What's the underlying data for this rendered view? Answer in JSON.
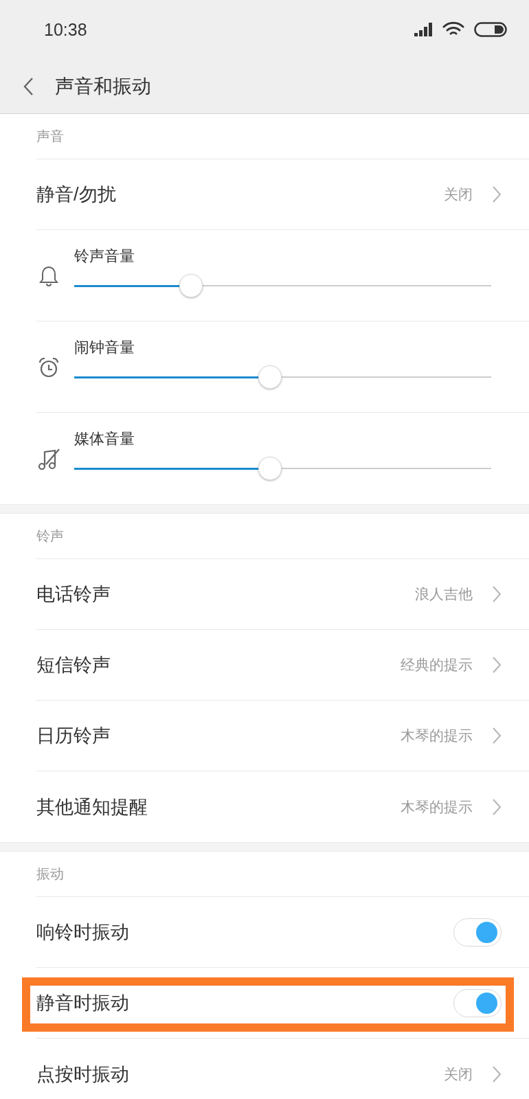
{
  "status_bar": {
    "time": "10:38"
  },
  "header": {
    "title": "声音和振动"
  },
  "sections": [
    {
      "title": "声音",
      "items": [
        {
          "kind": "link",
          "label": "静音/勿扰",
          "value": "关闭",
          "highlighted": false
        },
        {
          "kind": "slider",
          "label": "铃声音量",
          "level": 0.28,
          "highlighted": false
        },
        {
          "kind": "slider",
          "label": "闹钟音量",
          "level": 0.47,
          "highlighted": false
        },
        {
          "kind": "slider",
          "label": "媒体音量",
          "level": 0.47,
          "highlighted": false
        }
      ]
    },
    {
      "title": "铃声",
      "items": [
        {
          "kind": "link",
          "label": "电话铃声",
          "value": "浪人吉他",
          "highlighted": false
        },
        {
          "kind": "link",
          "label": "短信铃声",
          "value": "经典的提示",
          "highlighted": false
        },
        {
          "kind": "link",
          "label": "日历铃声",
          "value": "木琴的提示",
          "highlighted": false
        },
        {
          "kind": "link",
          "label": "其他通知提醒",
          "value": "木琴的提示",
          "highlighted": false
        }
      ]
    },
    {
      "title": "振动",
      "items": [
        {
          "kind": "toggle",
          "label": "响铃时振动",
          "on": true,
          "highlighted": false
        },
        {
          "kind": "toggle",
          "label": "静音时振动",
          "on": true,
          "highlighted": true
        },
        {
          "kind": "link",
          "label": "点按时振动",
          "value": "关闭",
          "highlighted": false
        }
      ]
    }
  ]
}
